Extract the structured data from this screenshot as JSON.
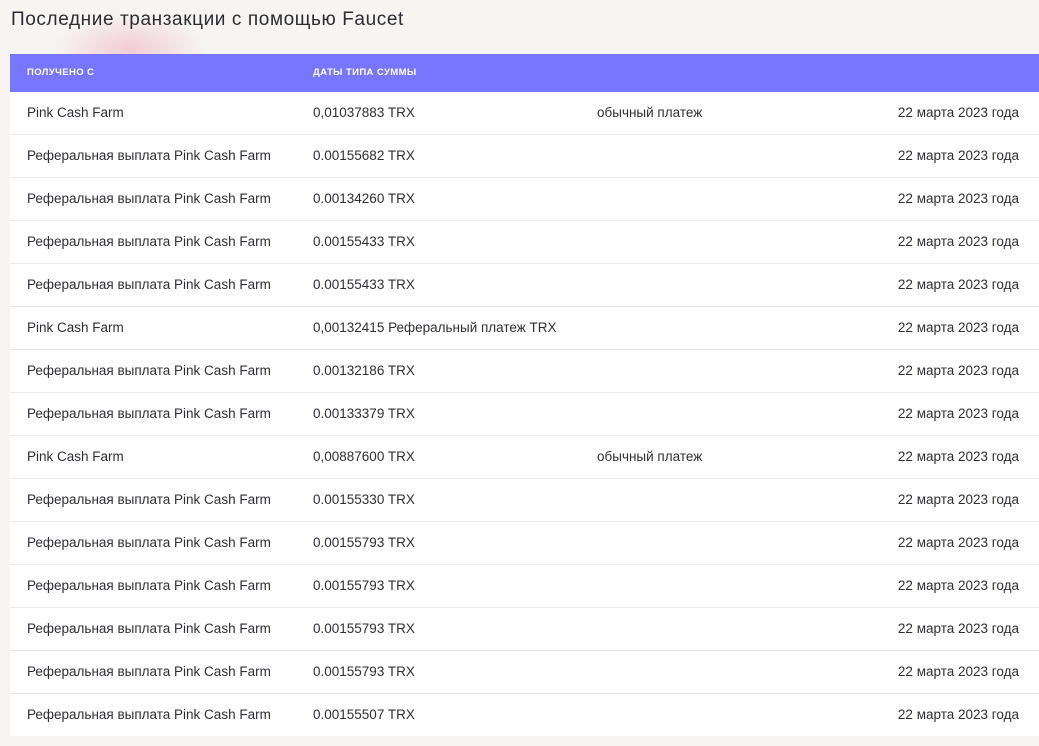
{
  "page": {
    "title": "Последние транзакции с помощью Faucet"
  },
  "table": {
    "headers": {
      "from": "ПОЛУЧЕНО С",
      "amount": "ДАТЫ ТИПА СУММЫ"
    },
    "rows": [
      {
        "from": "Pink Cash Farm",
        "amount": "0,01037883 TRX",
        "type": "обычный платеж",
        "date": "22 марта 2023 года"
      },
      {
        "from": "Реферальная выплата Pink Cash Farm",
        "amount": "0.00155682 TRX",
        "type": "",
        "date": "22 марта 2023 года"
      },
      {
        "from": "Реферальная выплата Pink Cash Farm",
        "amount": "0.00134260 TRX",
        "type": "",
        "date": "22 марта 2023 года"
      },
      {
        "from": "Реферальная выплата Pink Cash Farm",
        "amount": "0.00155433 TRX",
        "type": "",
        "date": "22 марта 2023 года"
      },
      {
        "from": "Реферальная выплата Pink Cash Farm",
        "amount": "0.00155433 TRX",
        "type": "",
        "date": "22 марта 2023 года"
      },
      {
        "from": "Pink Cash Farm",
        "amount": "0,00132415 Реферальный платеж TRX",
        "type": "",
        "date": "22 марта 2023 года"
      },
      {
        "from": "Реферальная выплата Pink Cash Farm",
        "amount": "0.00132186 TRX",
        "type": "",
        "date": "22 марта 2023 года"
      },
      {
        "from": "Реферальная выплата Pink Cash Farm",
        "amount": "0.00133379 TRX",
        "type": "",
        "date": "22 марта 2023 года"
      },
      {
        "from": "Pink Cash Farm",
        "amount": "0,00887600 TRX",
        "type": "обычный платеж",
        "date": "22 марта 2023 года"
      },
      {
        "from": "Реферальная выплата Pink Cash Farm",
        "amount": "0.00155330 TRX",
        "type": "",
        "date": "22 марта 2023 года"
      },
      {
        "from": "Реферальная выплата Pink Cash Farm",
        "amount": "0.00155793 TRX",
        "type": "",
        "date": "22 марта 2023 года"
      },
      {
        "from": "Реферальная выплата Pink Cash Farm",
        "amount": "0.00155793 TRX",
        "type": "",
        "date": "22 марта 2023 года"
      },
      {
        "from": "Реферальная выплата Pink Cash Farm",
        "amount": "0.00155793 TRX",
        "type": "",
        "date": "22 марта 2023 года"
      },
      {
        "from": "Реферальная выплата Pink Cash Farm",
        "amount": "0.00155793 TRX",
        "type": "",
        "date": "22 марта 2023 года"
      },
      {
        "from": "Реферальная выплата Pink Cash Farm",
        "amount": "0.00155507 TRX",
        "type": "",
        "date": "22 марта 2023 года"
      }
    ]
  },
  "colors": {
    "header_background": "#7875fe",
    "page_background": "#f7f5f1"
  }
}
